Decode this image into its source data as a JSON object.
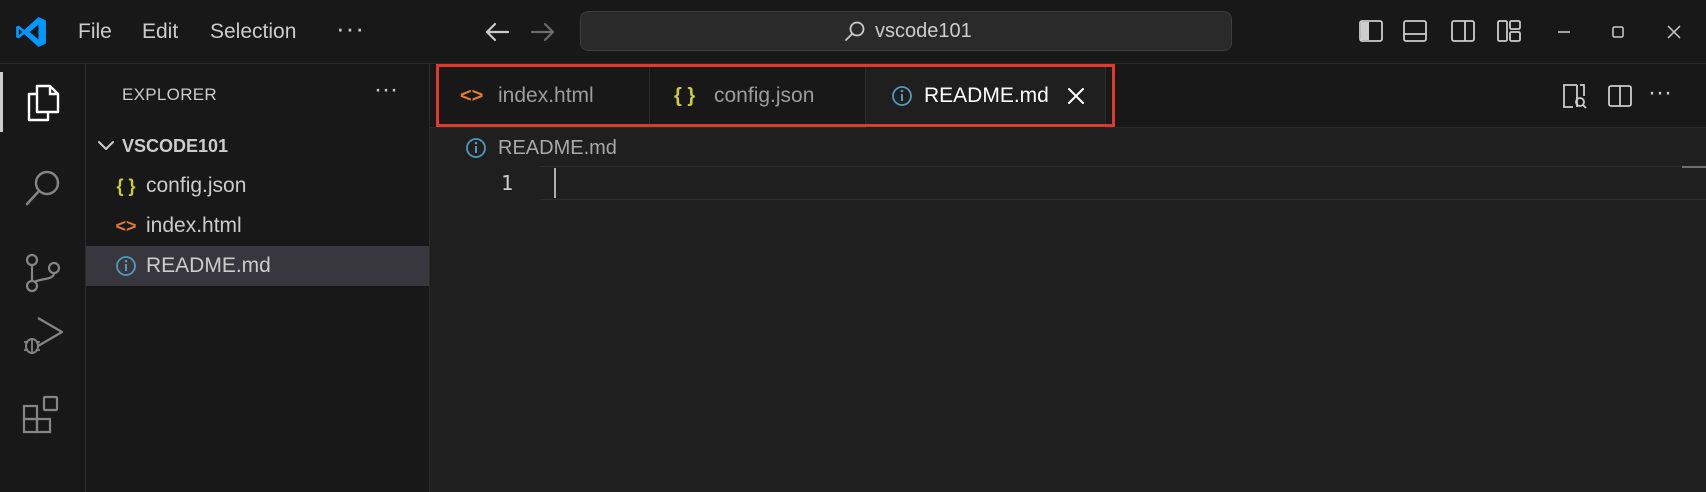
{
  "titlebar": {
    "menu": [
      "File",
      "Edit",
      "Selection"
    ],
    "overflow_label": "···",
    "command_center": "vscode101",
    "logo_color": "#0098ff"
  },
  "activitybar": {
    "items": [
      "explorer-icon",
      "search-icon",
      "source-control-icon",
      "run-debug-icon",
      "extensions-icon"
    ]
  },
  "sidebar": {
    "title": "EXPLORER",
    "more_label": "···",
    "folder": "VSCODE101",
    "files": [
      {
        "icon": "{ }",
        "name": "config.json",
        "color": "#cbcb41"
      },
      {
        "icon": "<>",
        "name": "index.html",
        "color": "#e37933"
      },
      {
        "icon": "i",
        "name": "README.md",
        "color": "#519aba"
      }
    ]
  },
  "editor": {
    "tabs": [
      {
        "icon": "<>",
        "label": "index.html",
        "color": "#e37933",
        "active": false
      },
      {
        "icon": "{ }",
        "label": "config.json",
        "color": "#cbcb41",
        "active": false
      },
      {
        "icon": "i",
        "label": "README.md",
        "color": "#519aba",
        "active": true
      }
    ],
    "breadcrumb": "README.md",
    "line_number": "1",
    "more_label": "···"
  },
  "colors": {
    "highlight_box": "#e03a2f",
    "background": "#1f1f1f",
    "sidebar": "#181818"
  }
}
